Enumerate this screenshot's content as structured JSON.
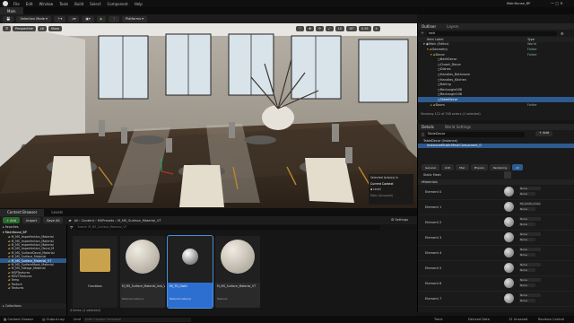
{
  "menu": {
    "items": [
      "File",
      "Edit",
      "Window",
      "Tools",
      "Build",
      "Select",
      "Component",
      "Help"
    ],
    "project": "MainHouse_BP"
  },
  "tabs": {
    "main": "Main"
  },
  "toolbar": {
    "mode": "Selection Mode",
    "platforms": "Platforms"
  },
  "viewport": {
    "perspective": "Perspective",
    "lit": "Lit",
    "show": "Show",
    "context_title": "Current Context",
    "context_value": "Level",
    "context_hint": "Selected Actor(s) in",
    "watermark": "Main (Unsaved)"
  },
  "outliner": {
    "tab1": "Outliner",
    "tab2": "Layers",
    "search": "srch",
    "col_label": "Item Label",
    "col_type": "Type",
    "rows": [
      {
        "label": "Main (Editor)",
        "type": "World"
      },
      {
        "label": "Geometry",
        "type": "Folder"
      },
      {
        "label": "Decor",
        "type": "Folder"
      },
      {
        "label": "BathDecor",
        "type": ""
      },
      {
        "label": "Closet_Decor",
        "type": ""
      },
      {
        "label": "Dishes",
        "type": ""
      },
      {
        "label": "Handles_Bathroom",
        "type": ""
      },
      {
        "label": "Handles_Kitchen",
        "type": ""
      },
      {
        "label": "Railing",
        "type": ""
      },
      {
        "label": "Rectangle008",
        "type": ""
      },
      {
        "label": "Rectangle108",
        "type": ""
      },
      {
        "label": "TableDecor",
        "type": ""
      },
      {
        "label": "Doors",
        "type": "Folder"
      }
    ],
    "count": "Showing 112 of 748 actors (1 selected)"
  },
  "details": {
    "tab1": "Details",
    "tab2": "World Settings",
    "actor": "TableDecor",
    "add": "+ Add",
    "root": "TableDecor (Instance)",
    "component": "InstancedStaticMeshComponent_0",
    "filters": [
      "General",
      "LOD",
      "Misc",
      "Physics",
      "Rendering",
      "All"
    ],
    "static_mesh": "Static Mesh",
    "materials": "Materials",
    "elements": [
      {
        "label": "Element 0",
        "mat": "None",
        "sub": "None"
      },
      {
        "label": "Element 1",
        "mat": "MI_Cloth_Linen",
        "sub": "None"
      },
      {
        "label": "Element 2",
        "mat": "None",
        "sub": "None"
      },
      {
        "label": "Element 3",
        "mat": "None",
        "sub": "None"
      },
      {
        "label": "Element 4",
        "mat": "None",
        "sub": "None"
      },
      {
        "label": "Element 5",
        "mat": "None",
        "sub": "None"
      },
      {
        "label": "Element 6",
        "mat": "None",
        "sub": "None"
      },
      {
        "label": "Element 7",
        "mat": "None",
        "sub": "None"
      }
    ]
  },
  "content_browser": {
    "tab1": "Content Browser",
    "tab2": "Levels",
    "add": "+ Add",
    "import": "Import",
    "save_all": "Save All",
    "path": [
      "All",
      "Content",
      "MSPresets",
      "M_MS_Surface_Material_VT"
    ],
    "search_placeholder": "Search M_MS_Surface_Material_VT",
    "settings": "Settings",
    "favorites": "Favorites",
    "root": "MainHouse_BP",
    "tree": [
      "M_MS_Imperfection_Material",
      "M_MS_Imperfection_Material",
      "M_MS_Imperfection_Material",
      "M_MS_Imperfection_Decal_M",
      "M_MS_SurfaceDecal_Material",
      "M_MS_Surface_Material",
      "M_MS_Surface_Material_VT",
      "M_MS_SurfaceMask_Material",
      "M_MS_Foliage_Material",
      "MSPTextures",
      "MSVTTextures",
      "Temp",
      "Texture",
      "Textures"
    ],
    "selected_index": 6,
    "collections": "Collections",
    "assets": [
      {
        "name": "Functions",
        "sub": ""
      },
      {
        "name": "M_MS_Surface_Material_Inst_VT",
        "sub": "Material Instance"
      },
      {
        "name": "MI_TG_Cloth",
        "sub": "Material Instance"
      },
      {
        "name": "M_MS_Surface_Material_VT",
        "sub": "Material"
      }
    ],
    "item_count": "4 items (1 selected)"
  },
  "statusbar": {
    "drawer": "Content Drawer",
    "log": "Output Log",
    "cmd": "Cmd",
    "console_placeholder": "Enter Console Command",
    "trace": "Trace",
    "derived": "Derived Data",
    "unsaved": "12 Unsaved",
    "revision": "Revision Control"
  }
}
